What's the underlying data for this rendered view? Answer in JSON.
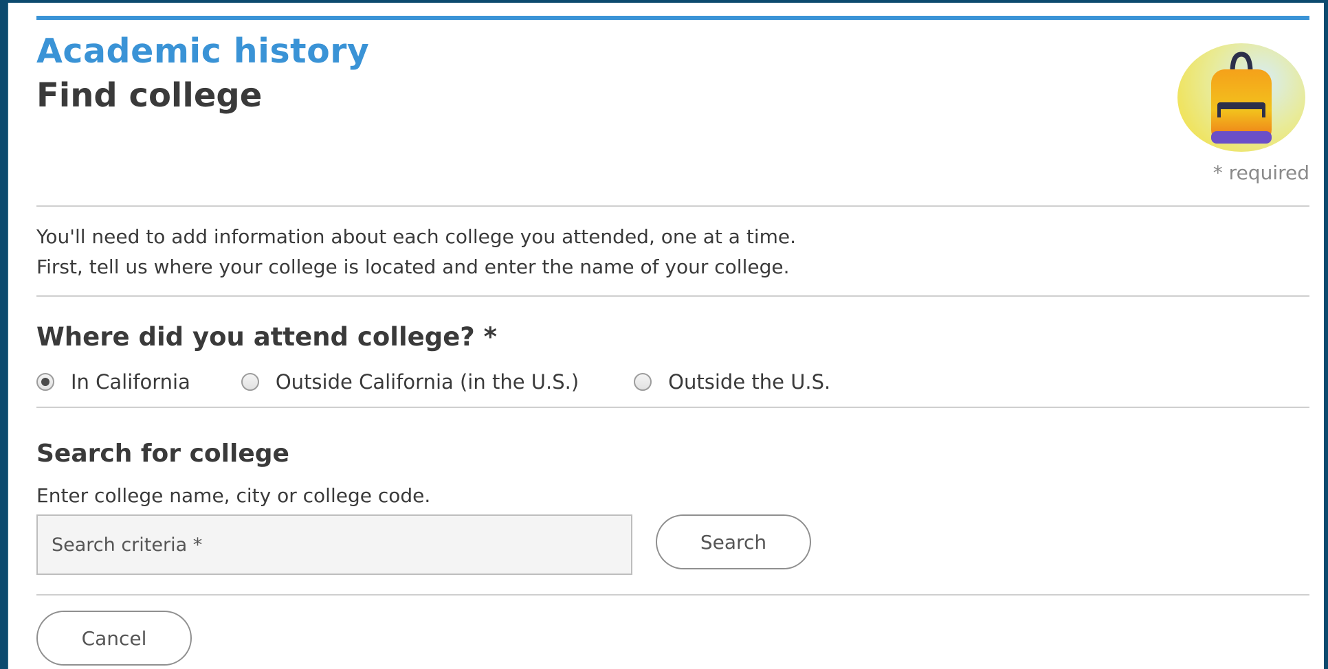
{
  "header": {
    "section_title": "Academic history",
    "page_title": "Find college",
    "required_note": "* required",
    "avatar_icon": "backpack-icon"
  },
  "intro": {
    "line1": "You'll need to add information about each college you attended, one at a time.",
    "line2": "First, tell us where your college is located and enter the name of your college."
  },
  "location": {
    "question": "Where did you attend college? *",
    "options": [
      {
        "label": "In California",
        "selected": true
      },
      {
        "label": "Outside California (in the U.S.)",
        "selected": false
      },
      {
        "label": "Outside the U.S.",
        "selected": false
      }
    ]
  },
  "search": {
    "heading": "Search for college",
    "help": "Enter college name, city or college code.",
    "placeholder": "Search criteria *",
    "value": "",
    "button_label": "Search"
  },
  "actions": {
    "cancel_label": "Cancel"
  },
  "colors": {
    "accent": "#3a93d6",
    "text": "#3a3a3a",
    "frame": "#0c4a6e"
  }
}
